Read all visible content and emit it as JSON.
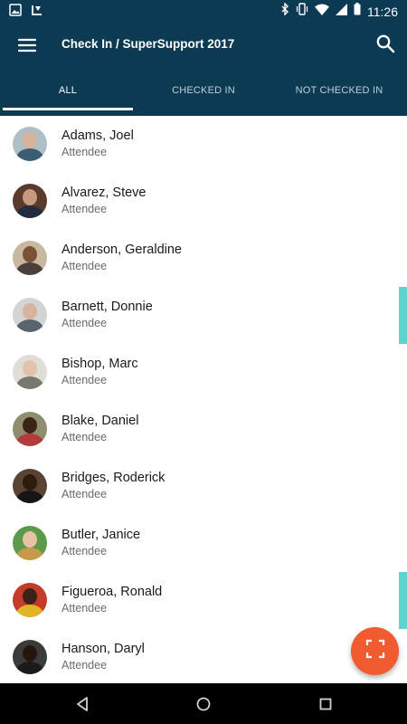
{
  "status_bar": {
    "time": "11:26"
  },
  "app_bar": {
    "title": "Check In / SuperSupport 2017",
    "tabs": [
      {
        "label": "ALL",
        "active": true
      },
      {
        "label": "CHECKED IN",
        "active": false
      },
      {
        "label": "NOT CHECKED IN",
        "active": false
      }
    ]
  },
  "attendees": [
    {
      "name": "Adams, Joel",
      "role": "Attendee",
      "avatar_colors": {
        "bg": "#aebfc6",
        "head": "#d8b39a",
        "body": "#3d5d74"
      }
    },
    {
      "name": "Alvarez, Steve",
      "role": "Attendee",
      "avatar_colors": {
        "bg": "#5a3a2a",
        "head": "#c79a7d",
        "body": "#232c3e"
      }
    },
    {
      "name": "Anderson, Geraldine",
      "role": "Attendee",
      "avatar_colors": {
        "bg": "#c9b8a0",
        "head": "#7a5136",
        "body": "#4a3f3a"
      }
    },
    {
      "name": "Barnett, Donnie",
      "role": "Attendee",
      "avatar_colors": {
        "bg": "#d4d4d4",
        "head": "#d7b49d",
        "body": "#5a6470"
      }
    },
    {
      "name": "Bishop, Marc",
      "role": "Attendee",
      "avatar_colors": {
        "bg": "#e0ddd6",
        "head": "#e2c2aa",
        "body": "#7a7670"
      }
    },
    {
      "name": "Blake, Daniel",
      "role": "Attendee",
      "avatar_colors": {
        "bg": "#8f8f6f",
        "head": "#3b2417",
        "body": "#b23b3b"
      }
    },
    {
      "name": "Bridges, Roderick",
      "role": "Attendee",
      "avatar_colors": {
        "bg": "#5a4234",
        "head": "#2e1b10",
        "body": "#151515"
      }
    },
    {
      "name": "Butler, Janice",
      "role": "Attendee",
      "avatar_colors": {
        "bg": "#5b9a4a",
        "head": "#e7c2a6",
        "body": "#c79a4a"
      }
    },
    {
      "name": "Figueroa, Ronald",
      "role": "Attendee",
      "avatar_colors": {
        "bg": "#c43b2a",
        "head": "#3a2216",
        "body": "#e0b52a"
      }
    },
    {
      "name": "Hanson, Daryl",
      "role": "Attendee",
      "avatar_colors": {
        "bg": "#3b3b3b",
        "head": "#25150c",
        "body": "#1b1b1b"
      }
    }
  ],
  "colors": {
    "app_bar": "#0b3a52",
    "fab": "#f25b2f",
    "scroll_marker": "#62d3cc"
  },
  "icons": {
    "menu": "menu-icon",
    "search": "search-icon",
    "fab": "scan-qr-icon"
  }
}
